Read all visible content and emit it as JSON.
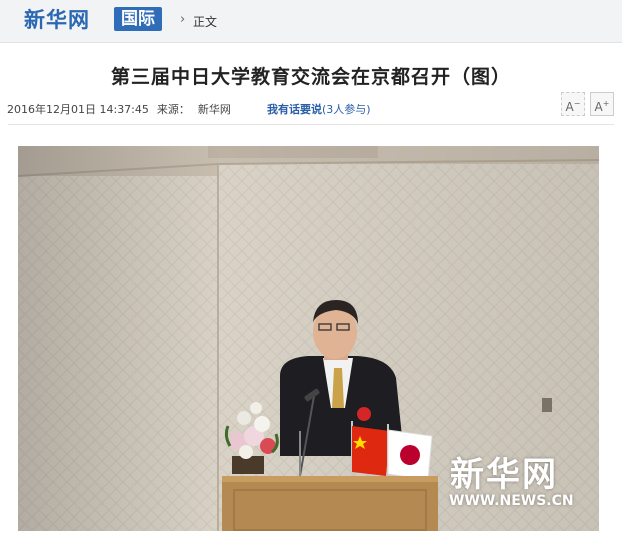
{
  "header": {
    "logo_text": "新华网",
    "channel_label": "国际",
    "breadcrumb_arrow": "›",
    "breadcrumb_current": "正文"
  },
  "article": {
    "title": "第三届中日大学教育交流会在京都召开（图）",
    "datetime": "2016年12月01日 14:37:45",
    "source_label": "来源：",
    "source_name": "新华网",
    "comment_link": "我有话要说",
    "comment_count": "(3人参与)",
    "font_decrease": "A",
    "font_increase": "A"
  },
  "photo": {
    "watermark_text": "新华网",
    "watermark_url": "WWW.NEWS.CN"
  },
  "colors": {
    "brand_blue": "#2a68b3",
    "channel_bg": "#2f6db8",
    "link_blue": "#2a5fa8"
  },
  "icons": [
    "chevron-right-icon",
    "font-decrease-icon",
    "font-increase-icon"
  ]
}
